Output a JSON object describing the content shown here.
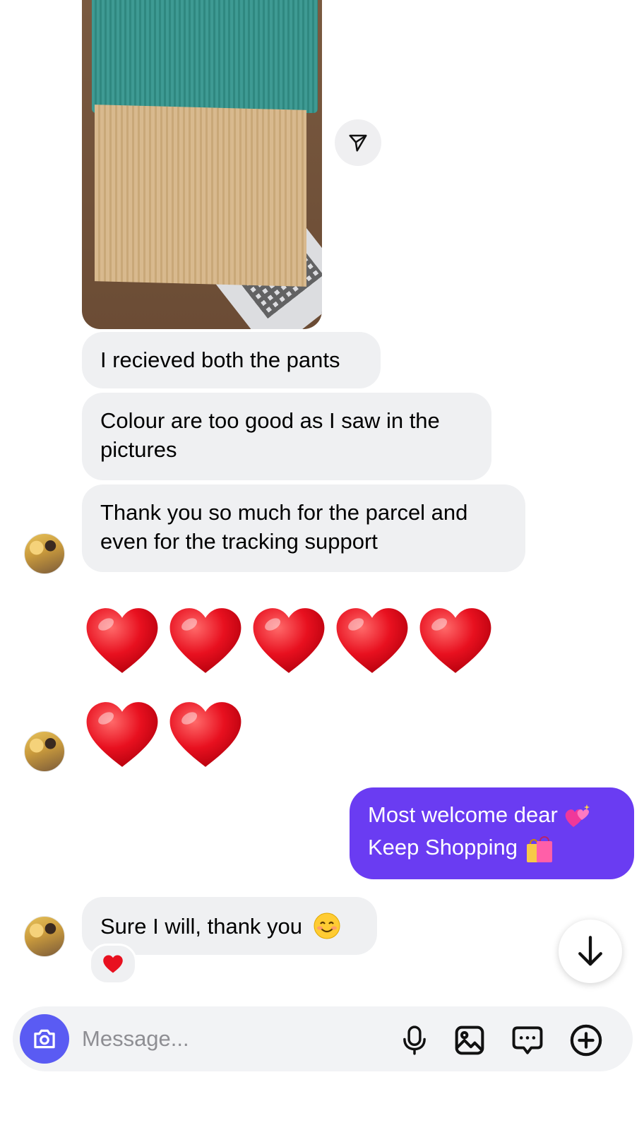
{
  "messages": {
    "m1": "I recieved both the pants",
    "m2": "Colour are too good as I saw in the pictures",
    "m3": "Thank you so much for the parcel and even for the tracking support",
    "m4": "Sure I will, thank you",
    "reply_line1": "Most welcome dear",
    "reply_line2": "Keep Shopping"
  },
  "hearts_row1": 5,
  "hearts_row2": 2,
  "composer": {
    "placeholder": "Message..."
  },
  "icons": [
    "share-icon",
    "camera-icon",
    "mic-icon",
    "gallery-icon",
    "sticker-icon",
    "plus-icon",
    "arrow-down-icon",
    "heart-reaction-icon"
  ],
  "colors": {
    "outgoing_bubble": "#6a3cf2",
    "incoming_bubble": "#eff0f2",
    "camera_button": "#5a5bf3",
    "heart": "#e8101f"
  }
}
